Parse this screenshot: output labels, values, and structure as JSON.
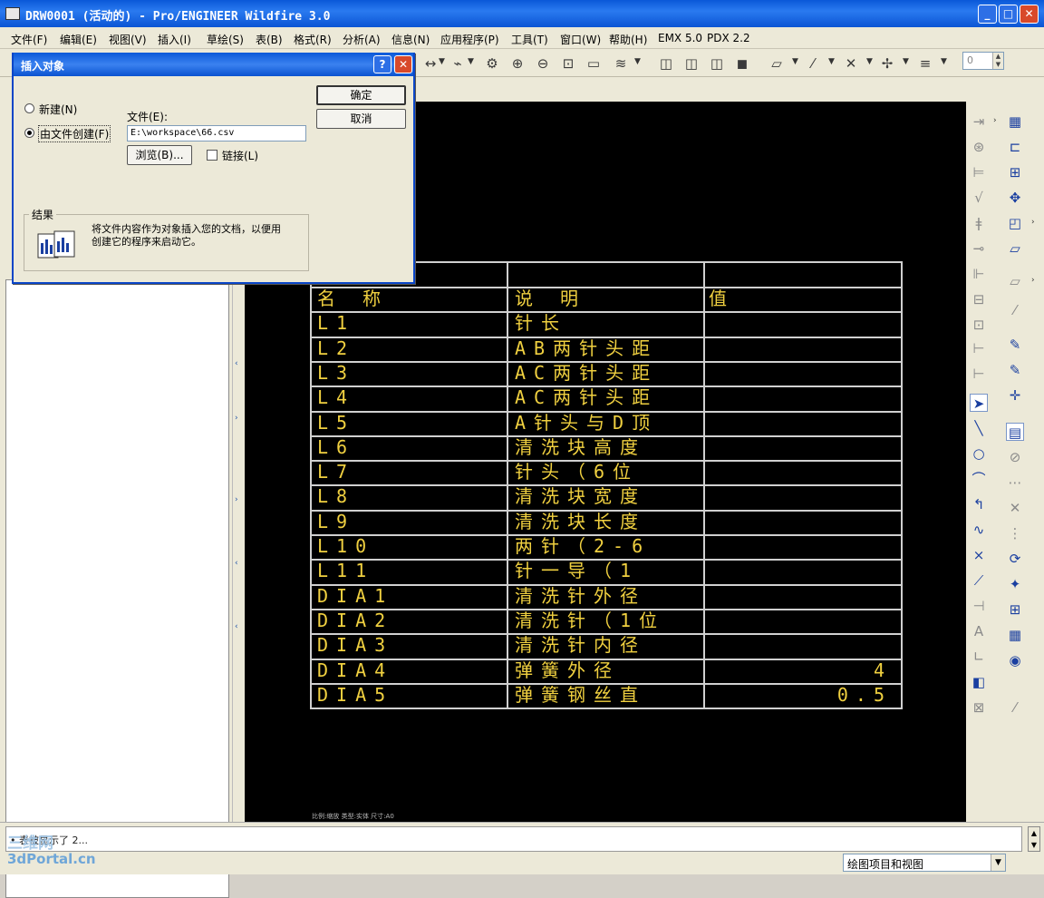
{
  "window": {
    "title": "DRW0001 (活动的) - Pro/ENGINEER Wildfire 3.0",
    "minimize": "_",
    "maximize": "□",
    "close": "✕"
  },
  "menubar": [
    "文件(F)",
    "编辑(E)",
    "视图(V)",
    "插入(I)",
    "草绘(S)",
    "表(B)",
    "格式(R)",
    "分析(A)",
    "信息(N)",
    "应用程序(P)",
    "工具(T)",
    "窗口(W)",
    "帮助(H)",
    "EMX 5.0",
    "PDX 2.2"
  ],
  "toolbar": {
    "spin_value": "0"
  },
  "dialog": {
    "title": "插入对象",
    "help_glyph": "?",
    "close_glyph": "✕",
    "radio_new": "新建(N)",
    "radio_from_file": "由文件创建(F)",
    "selected": "from_file",
    "file_label": "文件(E):",
    "file_value": "E:\\workspace\\66.csv",
    "browse": "浏览(B)...",
    "link_label": "链接(L)",
    "link_checked": false,
    "ok": "确定",
    "cancel": "取消",
    "result_group": "结果",
    "result_text_1": "将文件内容作为对象插入您的文档，以便用",
    "result_text_2": "创建它的程序来启动它。"
  },
  "table": {
    "header": [
      "名 称",
      "说 明",
      "值"
    ],
    "rows": [
      [
        "L1",
        "针长",
        ""
      ],
      [
        "L2",
        "AB两针头距",
        ""
      ],
      [
        "L3",
        "AC两针头距",
        ""
      ],
      [
        "L4",
        "AC两针头距",
        ""
      ],
      [
        "L5",
        "A针头与D顶",
        ""
      ],
      [
        "L6",
        "清洗块高度",
        ""
      ],
      [
        "L7",
        "针头（6位",
        ""
      ],
      [
        "L8",
        "清洗块宽度",
        ""
      ],
      [
        "L9",
        "清洗块长度",
        ""
      ],
      [
        "L10",
        "两针（2-6",
        ""
      ],
      [
        "L11",
        "针一导（1",
        ""
      ],
      [
        "DIA1",
        "清洗针外径",
        ""
      ],
      [
        "DIA2",
        "清洗针（1位",
        ""
      ],
      [
        "DIA3",
        "清洗针内径",
        ""
      ],
      [
        "DIA4",
        "弹簧外径",
        "4"
      ],
      [
        "DIA5",
        "弹簧钢丝直",
        "0.5"
      ]
    ]
  },
  "sheet_footer": "比例:缩放   类型:实体   尺寸:A0",
  "status": {
    "message": "• 表被显示了 2...",
    "filter": "绘图项目和视图",
    "watermark_1": "三维网",
    "watermark_2": "3dPortal.cn"
  },
  "colors": {
    "titlebar": "#0a58d8",
    "canvas": "#000000",
    "table_text": "#f0d040",
    "table_lines": "#d0d0d0"
  }
}
